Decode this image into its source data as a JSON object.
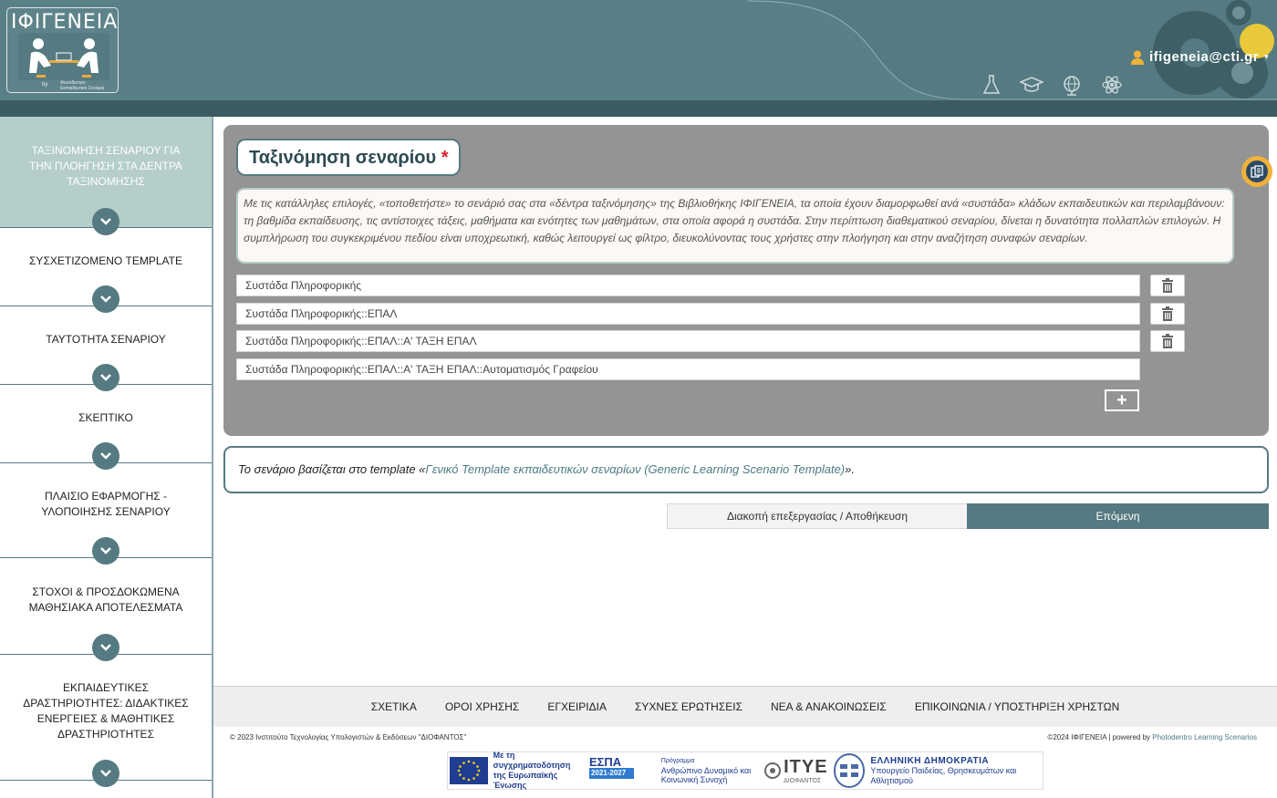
{
  "header": {
    "logo_title": "ΙΦΙΓΕΝΕΙΑ",
    "logo_by": "by",
    "logo_sub_1": "Φωτόδεντρο",
    "logo_sub_2": "Εκπαιδευτικά Σενάρια",
    "icons": [
      "flask-icon",
      "graduation-cap-icon",
      "globe-icon",
      "atom-icon"
    ],
    "user_email": "ifigeneia@cti.gr"
  },
  "sidebar": {
    "items": [
      {
        "label": "ΤΑΞΙΝΟΜΗΣΗ ΣΕΝΑΡΙΟΥ ΓΙΑ ΤΗΝ ΠΛΟΗΓΗΣΗ ΣΤΑ ΔΕΝΤΡΑ ΤΑΞΙΝΟΜΗΣΗΣ",
        "active": true
      },
      {
        "label": "ΣΥΣΧΕΤΙΖΟΜΕΝΟ TEMPLATE",
        "active": false
      },
      {
        "label": "ΤΑΥΤΟΤΗΤΑ ΣΕΝΑΡΙΟΥ",
        "active": false
      },
      {
        "label": "ΣΚΕΠΤΙΚΟ",
        "active": false
      },
      {
        "label": "ΠΛΑΙΣΙΟ ΕΦΑΡΜΟΓΗΣ - ΥΛΟΠΟΙΗΣΗΣ ΣΕΝΑΡΙΟΥ",
        "active": false
      },
      {
        "label": "ΣΤΟΧΟΙ & ΠΡΟΣΔΟΚΩΜΕΝΑ ΜΑΘΗΣΙΑΚΑ ΑΠΟΤΕΛΕΣΜΑΤΑ",
        "active": false
      },
      {
        "label": "ΕΚΠΑΙΔΕΥΤΙΚΕΣ ΔΡΑΣΤΗΡΙΟΤΗΤΕΣ: ΔΙΔΑΚΤΙΚΕΣ ΕΝΕΡΓΕΙΕΣ & ΜΑΘΗΤΙΚΕΣ ΔΡΑΣΤΗΡΙΟΤΗΤΕΣ",
        "active": false
      }
    ]
  },
  "panel": {
    "title": "Ταξινόμηση σεναρίου",
    "required_mark": "*",
    "description": "Με τις κατάλληλες επιλογές, «τοποθετήστε» το σενάριό σας στα «δέντρα ταξινόμησης» της Βιβλιοθήκης ΙΦΙΓΕΝΕΙΑ, τα οποία έχουν διαμορφωθεί ανά «συστάδα» κλάδων εκπαιδευτικών και περιλαμβάνουν: τη βαθμίδα εκπαίδευσης, τις αντίστοιχες τάξεις, μαθήματα και ενότητες των μαθημάτων, στα οποία αφορά η συστάδα. Στην περίπτωση διαθεματικού σεναρίου, δίνεται η δυνατότητα πολλαπλών επιλογών. Η συμπλήρωση του συγκεκριμένου πεδίου είναι υποχρεωτική, καθώς λειτουργεί ως φίλτρο, διευκολύνοντας τους χρήστες στην πλοήγηση και στην αναζήτηση συναφών σεναρίων.",
    "rows": [
      "Συστάδα Πληροφορικής",
      "Συστάδα Πληροφορικής::ΕΠΑΛ",
      "Συστάδα Πληροφορικής::ΕΠΑΛ::Α' ΤΑΞΗ ΕΠΑΛ",
      "Συστάδα Πληροφορικής::ΕΠΑΛ::Α' ΤΑΞΗ ΕΠΑΛ::Αυτοματισμός Γραφείου"
    ],
    "add_label": "+"
  },
  "template_box": {
    "prefix": "Το σενάριο βασίζεται στο template «",
    "link": "Γενικό Template εκπαιδευτικών σεναρίων (Generic Learning Scenario Template)",
    "suffix": "»."
  },
  "actions": {
    "stop_label": "Διακοπή επεξεργασίας / Αποθήκευση",
    "next_label": "Επόμενη"
  },
  "footer": {
    "nav": [
      "ΣΧΕΤΙΚΑ",
      "ΟΡΟΙ ΧΡΗΣΗΣ",
      "ΕΓΧΕΙΡΙΔΙΑ",
      "ΣΥΧΝΕΣ ΕΡΩΤΗΣΕΙΣ",
      "ΝΕΑ & ΑΝΑΚΟΙΝΩΣΕΙΣ",
      "ΕΠΙΚΟΙΝΩΝΙΑ / ΥΠΟΣΤΗΡΙΞΗ ΧΡΗΣΤΩΝ"
    ],
    "copyright_left": "© 2023 Ινστιτούτο Τεχνολογίας Υπολογιστών & Εκδόσεων \"ΔΙΟΦΑΝΤΟΣ\"",
    "copyright_right": "©2024 ΙΦΙΓΕΝΕΙΑ | powered by ",
    "powered_link": "Photodentro Learning Scenarios",
    "espa_text": "Με τη συγχρηματοδότηση της Ευρωπαϊκής Ένωσης",
    "espa_logo": "ΕΣΠΑ",
    "espa_years": "2021-2027",
    "program_label": "Πρόγραμμα",
    "program_name": "Ανθρώπινο Δυναμικό και Κοινωνική Συνοχή",
    "itye_name": "ΙΤΥΕ",
    "itye_sub": "ΔΙΟΦΑΝΤΟΣ",
    "gov_title": "ΕΛΛΗΝΙΚΗ ΔΗΜΟΚΡΑΤΙΑ",
    "gov_sub": "Υπουργείο Παιδείας, Θρησκευμάτων και Αθλητισμού"
  }
}
